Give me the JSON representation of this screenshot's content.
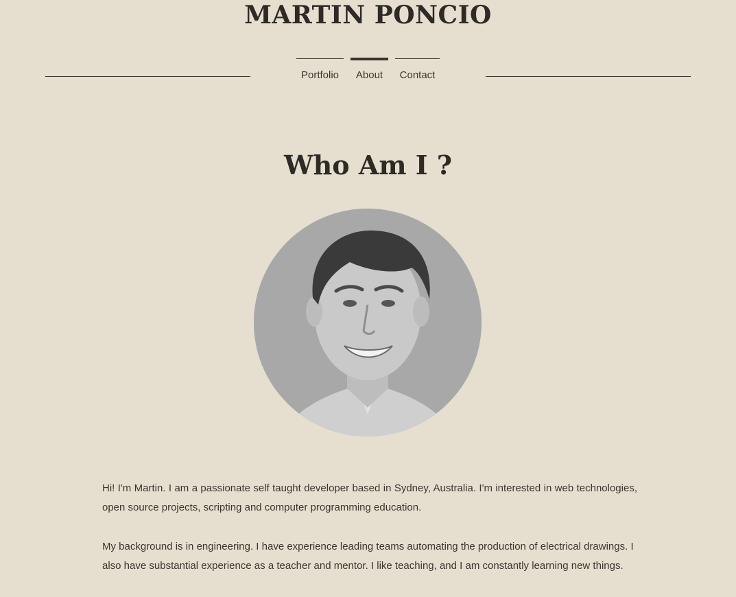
{
  "header": {
    "site_title": "MARTIN PONCIO"
  },
  "nav": {
    "items": [
      {
        "label": "Portfolio",
        "active": false
      },
      {
        "label": "About",
        "active": true
      },
      {
        "label": "Contact",
        "active": false
      }
    ]
  },
  "about": {
    "heading": "Who Am I ?",
    "paragraphs": [
      "Hi! I'm Martin. I am a passionate self taught developer based in Sydney, Australia. I'm interested in web technologies, open source projects, scripting and computer programming education.",
      "My background is in engineering. I  have experience leading teams automating the production of electrical drawings. I also have substantial experience as a teacher and mentor. I like teaching, and I am constantly learning new things."
    ]
  },
  "colors": {
    "background": "#e6dfd0",
    "text": "#2e2a25",
    "accent": "#3a352e"
  }
}
